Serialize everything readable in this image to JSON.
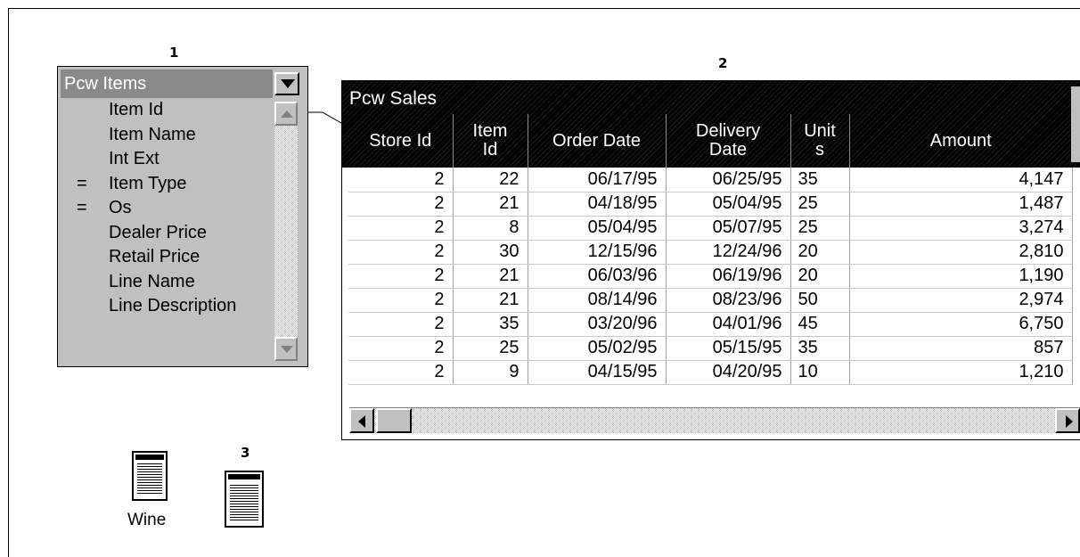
{
  "callouts": {
    "one": "1",
    "two": "2",
    "three": "3"
  },
  "items_window": {
    "title": "Pcw Items",
    "items": [
      {
        "mark": "",
        "label": "Item Id"
      },
      {
        "mark": "",
        "label": "Item Name"
      },
      {
        "mark": "",
        "label": "Int Ext"
      },
      {
        "mark": "=",
        "label": "Item Type"
      },
      {
        "mark": "=",
        "label": "Os"
      },
      {
        "mark": "",
        "label": "Dealer Price"
      },
      {
        "mark": "",
        "label": "Retail Price"
      },
      {
        "mark": "",
        "label": "Line Name"
      },
      {
        "mark": "",
        "label": "Line Description"
      }
    ]
  },
  "sales_window": {
    "title": "Pcw Sales",
    "columns": {
      "store_id": "Store Id",
      "item_id_1": "Item",
      "item_id_2": "Id",
      "order_date": "Order Date",
      "delivery_1": "Delivery",
      "delivery_2": "Date",
      "units_1": "Unit",
      "units_2": "s",
      "amount": "Amount"
    },
    "rows": [
      {
        "store": "2",
        "item": "22",
        "order": "06/17/95",
        "delivery": "06/25/95",
        "units": "35",
        "amount": "4,147"
      },
      {
        "store": "2",
        "item": "21",
        "order": "04/18/95",
        "delivery": "05/04/95",
        "units": "25",
        "amount": "1,487"
      },
      {
        "store": "2",
        "item": "8",
        "order": "05/04/95",
        "delivery": "05/07/95",
        "units": "25",
        "amount": "3,274"
      },
      {
        "store": "2",
        "item": "30",
        "order": "12/15/96",
        "delivery": "12/24/96",
        "units": "20",
        "amount": "2,810"
      },
      {
        "store": "2",
        "item": "21",
        "order": "06/03/96",
        "delivery": "06/19/96",
        "units": "20",
        "amount": "1,190"
      },
      {
        "store": "2",
        "item": "21",
        "order": "08/14/96",
        "delivery": "08/23/96",
        "units": "50",
        "amount": "2,974"
      },
      {
        "store": "2",
        "item": "35",
        "order": "03/20/96",
        "delivery": "04/01/96",
        "units": "45",
        "amount": "6,750"
      },
      {
        "store": "2",
        "item": "25",
        "order": "05/02/95",
        "delivery": "05/15/95",
        "units": "35",
        "amount": "857"
      },
      {
        "store": "2",
        "item": "9",
        "order": "04/15/95",
        "delivery": "04/20/95",
        "units": "10",
        "amount": "1,210"
      }
    ]
  },
  "icons": {
    "wine_label": "Wine"
  }
}
